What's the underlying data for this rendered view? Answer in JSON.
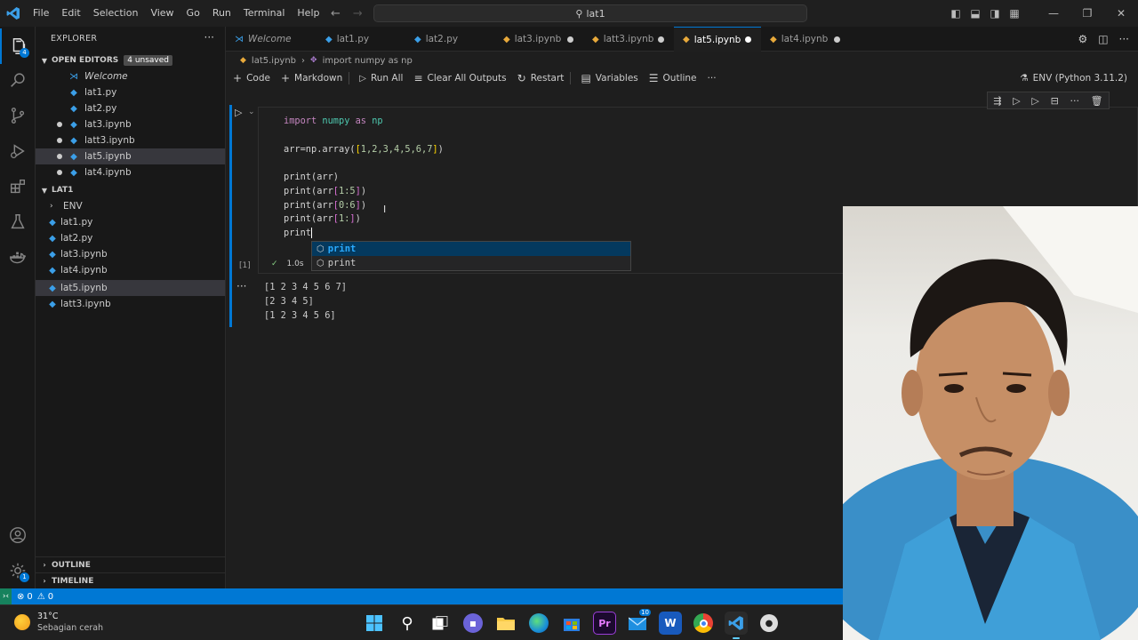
{
  "titlebar": {
    "menu": [
      "File",
      "Edit",
      "Selection",
      "View",
      "Go",
      "Run",
      "Terminal",
      "Help"
    ],
    "search": "lat1"
  },
  "activity": {
    "explorer_badge": "4",
    "settings_badge": "1"
  },
  "sidebar": {
    "title": "EXPLORER",
    "open_editors": {
      "header": "OPEN EDITORS",
      "unsaved": "4 unsaved",
      "items": [
        "Welcome",
        "lat1.py",
        "lat2.py",
        "lat3.ipynb",
        "latt3.ipynb",
        "lat5.ipynb",
        "lat4.ipynb"
      ]
    },
    "workspace": {
      "header": "LAT1",
      "items": [
        "ENV",
        "lat1.py",
        "lat2.py",
        "lat3.ipynb",
        "lat4.ipynb",
        "lat5.ipynb",
        "latt3.ipynb"
      ]
    },
    "outline": "OUTLINE",
    "timeline": "TIMELINE"
  },
  "tabs": [
    "Welcome",
    "lat1.py",
    "lat2.py",
    "lat3.ipynb",
    "latt3.ipynb",
    "lat5.ipynb",
    "lat4.ipynb"
  ],
  "breadcrumb": {
    "file": "lat5.ipynb",
    "symbol": "import numpy as np"
  },
  "toolbar": {
    "code": "Code",
    "markdown": "Markdown",
    "run_all": "Run All",
    "clear_outputs": "Clear All Outputs",
    "restart": "Restart",
    "variables": "Variables",
    "outline": "Outline",
    "kernel": "ENV (Python 3.11.2)"
  },
  "cell": {
    "line1": {
      "kw1": "import",
      "mod1": "numpy",
      "kw2": "as",
      "mod2": "np"
    },
    "line2": {
      "a": "arr=np.array(",
      "b": "[",
      "nums": "1,2,3,4,5,6,7",
      "c": "]",
      "d": ")"
    },
    "line3": {
      "a": "print(arr)"
    },
    "line4": {
      "a": "print(arr",
      "b": "[",
      "c": "1:5",
      "d": "]",
      "e": ")"
    },
    "line5": {
      "a": "print(arr",
      "b": "[",
      "c": "0:6",
      "d": "]",
      "e": ")"
    },
    "line6": {
      "a": "print(arr",
      "b": "[",
      "c": "1:",
      "d": "]",
      "e": ")"
    },
    "line7": "print",
    "exec_count": "[1]",
    "exec_time": "1.0s"
  },
  "suggest": [
    "print",
    "print"
  ],
  "output": [
    "[1 2 3 4 5 6 7]",
    "[2 3 4 5]",
    "[1 2 3 4 5 6]"
  ],
  "statusbar": {
    "errors": "0",
    "warnings": "0"
  },
  "taskbar": {
    "temp": "31°C",
    "weather": "Sebagian cerah",
    "mail_badge": "10"
  }
}
